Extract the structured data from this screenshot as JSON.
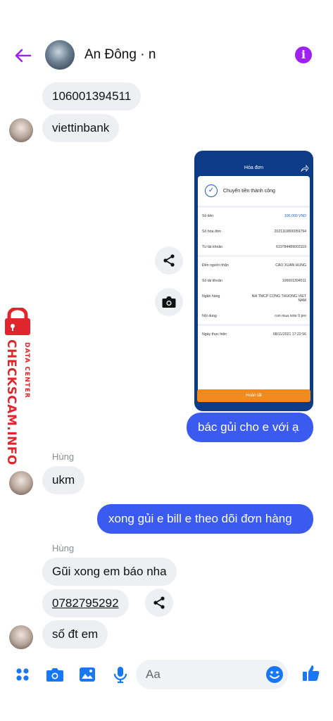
{
  "header": {
    "contact_name": "An Đông · n",
    "info_symbol": "i"
  },
  "messages": {
    "m1": "106001394511",
    "m2": "viettinbank",
    "m3": "bác gủi cho e với ạ",
    "m4_sender": "Hùng",
    "m4": "ukm",
    "m5": "xong gủi e bill e theo dõi đơn hàng",
    "m6_sender": "Hùng",
    "m6": "Gũi xong em báo nha",
    "m7": "0782795292",
    "m8": "số đt em"
  },
  "receipt": {
    "header_title": "Hóa đơn",
    "success_text": "Chuyển tiền thành công",
    "rows": [
      {
        "label": "Số tiền",
        "value": "100,000 VND"
      },
      {
        "label": "Số hóa đơn",
        "value": "2021110800059794"
      },
      {
        "label": "Từ tài khoản",
        "value": "619784489003119"
      },
      {
        "label": "Đến người nhận",
        "value": "CAO XUAN HUNG"
      },
      {
        "label": "Số tài khoản",
        "value": "106001394511"
      },
      {
        "label": "Ngân hàng",
        "value": "NH TMCP CONG THUONG VIET NAM"
      },
      {
        "label": "Nội dung",
        "value": "con mua note 9 pro"
      },
      {
        "label": "Ngày thực hiện",
        "value": "08/11/2021 17:22:56"
      }
    ],
    "done_button": "Hoàn tất",
    "amount_color": "#1d5fc2"
  },
  "watermark": {
    "main": "CHECKSCAM.INFO",
    "sub": "DATA CENTER"
  },
  "composer": {
    "placeholder": "Aa"
  },
  "colors": {
    "accent": "#a020f0",
    "outgoing_bubble": "#3a5af0",
    "icon_blue": "#1877f2",
    "watermark_red": "#e0262c"
  }
}
